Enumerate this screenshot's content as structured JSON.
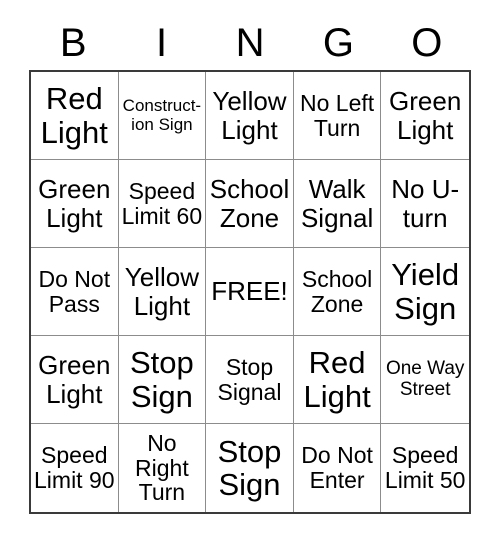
{
  "card": {
    "type": "bingo-card",
    "theme": "Traffic Signs and Signals",
    "columns": 5,
    "rows": 5,
    "headers": [
      "B",
      "I",
      "N",
      "G",
      "O"
    ],
    "free_space": {
      "row": 3,
      "column": 3,
      "label": "FREE!"
    },
    "colors": {
      "background": "#ffffff",
      "text": "#000000",
      "grid_line": "#8c8c8c",
      "outer_border": "#3a3a3a"
    },
    "cells": [
      [
        {
          "text": "Red Light",
          "size": "fs-xl"
        },
        {
          "text": "Construct-\nion Sign",
          "size": "fs-xs"
        },
        {
          "text": "Yellow Light",
          "size": "fs-lg"
        },
        {
          "text": "No Left Turn",
          "size": "fs-md"
        },
        {
          "text": "Green Light",
          "size": "fs-lg"
        }
      ],
      [
        {
          "text": "Green Light",
          "size": "fs-lg"
        },
        {
          "text": "Speed Limit 60",
          "size": "fs-md"
        },
        {
          "text": "School Zone",
          "size": "fs-lg"
        },
        {
          "text": "Walk Signal",
          "size": "fs-lg"
        },
        {
          "text": "No U-turn",
          "size": "fs-lg"
        }
      ],
      [
        {
          "text": "Do Not Pass",
          "size": "fs-md"
        },
        {
          "text": "Yellow Light",
          "size": "fs-lg"
        },
        {
          "text": "FREE!",
          "size": "fs-lg"
        },
        {
          "text": "School Zone",
          "size": "fs-md"
        },
        {
          "text": "Yield Sign",
          "size": "fs-xl"
        }
      ],
      [
        {
          "text": "Green Light",
          "size": "fs-lg"
        },
        {
          "text": "Stop Sign",
          "size": "fs-xl"
        },
        {
          "text": "Stop Signal",
          "size": "fs-md"
        },
        {
          "text": "Red Light",
          "size": "fs-xl"
        },
        {
          "text": "One Way Street",
          "size": "fs-sm"
        }
      ],
      [
        {
          "text": "Speed Limit 90",
          "size": "fs-md"
        },
        {
          "text": "No Right Turn",
          "size": "fs-md"
        },
        {
          "text": "Stop Sign",
          "size": "fs-xl"
        },
        {
          "text": "Do Not Enter",
          "size": "fs-md"
        },
        {
          "text": "Speed Limit 50",
          "size": "fs-md"
        }
      ]
    ]
  }
}
